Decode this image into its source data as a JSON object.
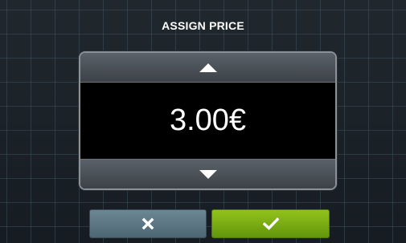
{
  "dialog": {
    "title": "ASSIGN PRICE",
    "price_value": "3.00€"
  },
  "icons": {
    "increase": "arrow-up-icon",
    "decrease": "arrow-down-icon",
    "cancel": "close-icon",
    "confirm": "checkmark-icon"
  },
  "colors": {
    "cancel_button": "#5b7684",
    "confirm_button": "#7bad12",
    "display_background": "#000000"
  }
}
